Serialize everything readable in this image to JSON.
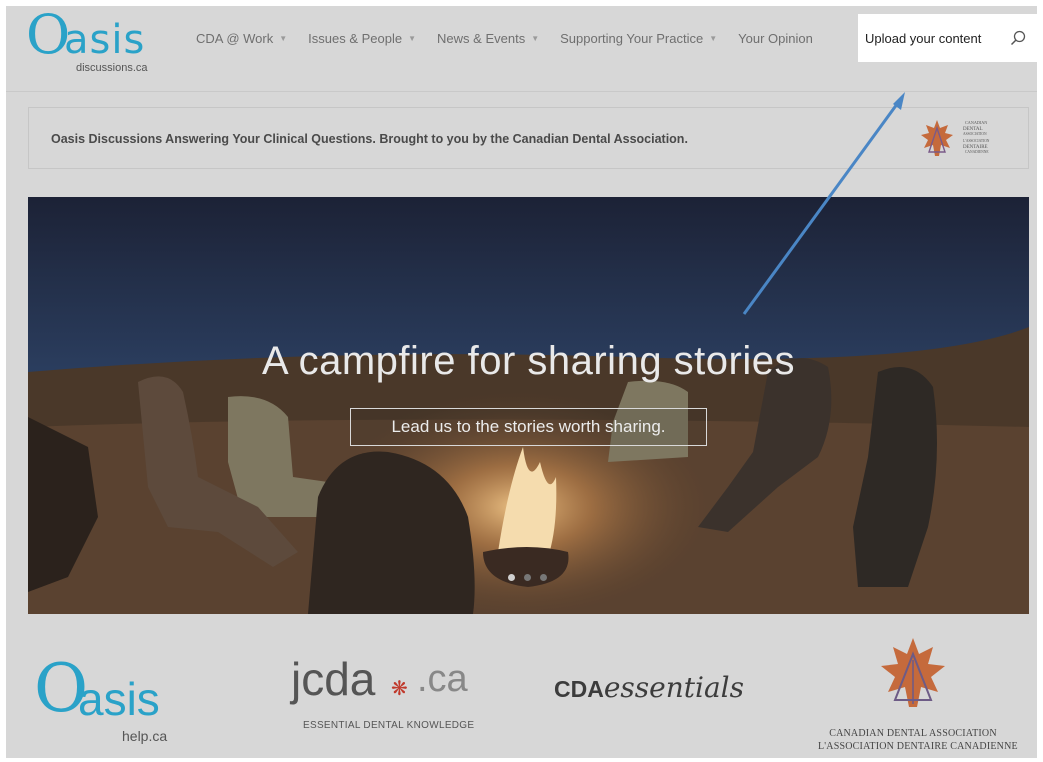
{
  "header": {
    "logo": {
      "letter": "O",
      "word": "asis",
      "sub": "discussions.ca"
    },
    "nav": [
      {
        "label": "CDA @ Work",
        "has_dropdown": true
      },
      {
        "label": "Issues & People",
        "has_dropdown": true
      },
      {
        "label": "News & Events",
        "has_dropdown": true
      },
      {
        "label": "Supporting Your Practice",
        "has_dropdown": true
      },
      {
        "label": "Your Opinion",
        "has_dropdown": false
      }
    ],
    "upload_label": "Upload your content",
    "search_icon": "search-icon"
  },
  "banner": {
    "text": "Oasis Discussions Answering Your Clinical Questions. Brought to you by the Canadian Dental Association.",
    "logo_lines": [
      "CANADIAN",
      "DENTAL",
      "ASSOCIATION",
      "L'ASSOCIATION",
      "DENTAIRE",
      "CANADIENNE"
    ]
  },
  "hero": {
    "title": "A campfire for sharing stories",
    "cta": "Lead us to the stories worth sharing.",
    "slides": 3,
    "active_slide": 1
  },
  "footer_logos": {
    "oasis_help": {
      "letter": "O",
      "word": "asis",
      "sub": "help.ca"
    },
    "jcda": {
      "main": "jcda",
      "ca": ".ca",
      "tag": "ESSENTIAL DENTAL KNOWLEDGE"
    },
    "cda_essentials": {
      "cda": "CDA",
      "ess": "essentials"
    },
    "cda": {
      "line1": "CANADIAN DENTAL ASSOCIATION",
      "line2": "L'ASSOCIATION DENTAIRE CANADIENNE"
    }
  },
  "colors": {
    "brand_blue": "#2aa2c8",
    "overlay_gray": "#d7d7d7",
    "maple_red": "#c0392b",
    "annotation_arrow": "#4a86c5"
  }
}
